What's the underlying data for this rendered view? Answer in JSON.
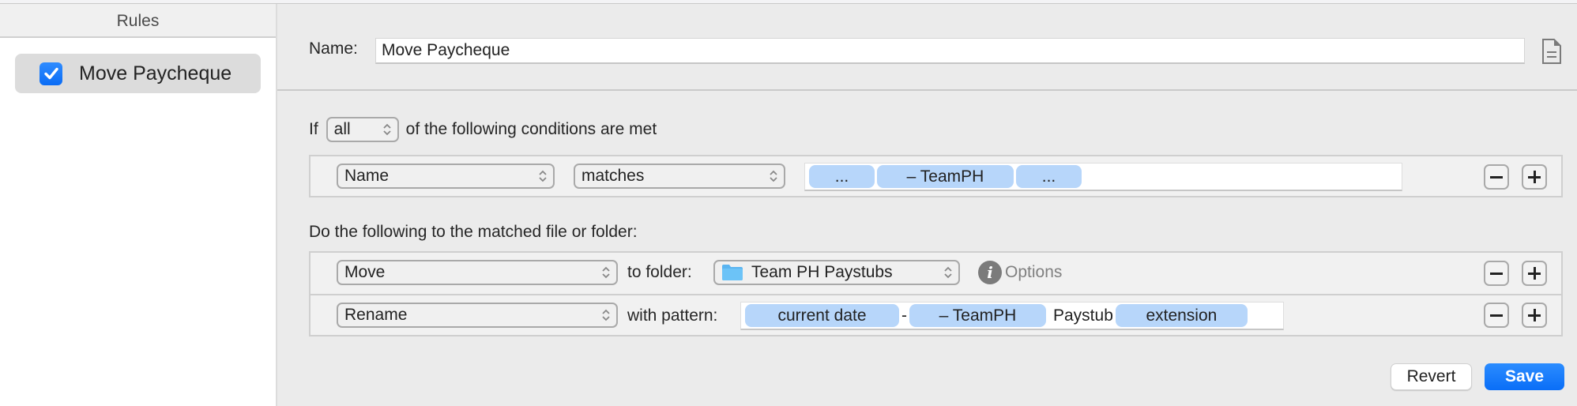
{
  "sidebar": {
    "header": "Rules",
    "rules": [
      {
        "label": "Move Paycheque",
        "enabled": true,
        "selected": true
      }
    ]
  },
  "editor": {
    "name_label": "Name:",
    "name_value": "Move Paycheque",
    "doc_icon": "document-icon",
    "conditions": {
      "prefix": "If",
      "match_mode": "all",
      "suffix": "of the following conditions are met",
      "rows": [
        {
          "attribute": "Name",
          "operator": "matches",
          "tokens": [
            "...",
            "– TeamPH",
            "..."
          ]
        }
      ]
    },
    "actions": {
      "heading": "Do the following to the matched file or folder:",
      "rows": [
        {
          "action": "Move",
          "connector": "to folder:",
          "folder": "Team PH Paystubs",
          "options_label": "Options"
        },
        {
          "action": "Rename",
          "connector": "with pattern:",
          "pattern": [
            {
              "type": "token",
              "text": "current date"
            },
            {
              "type": "text",
              "text": "-"
            },
            {
              "type": "token",
              "text": "– TeamPH"
            },
            {
              "type": "text",
              "text": "Paystub"
            },
            {
              "type": "token",
              "text": "extension"
            }
          ]
        }
      ]
    },
    "buttons": {
      "revert": "Revert",
      "save": "Save"
    }
  },
  "colors": {
    "accent": "#0a6ef7",
    "token": "#b7d6fa",
    "folder": "#5ab4f0"
  }
}
